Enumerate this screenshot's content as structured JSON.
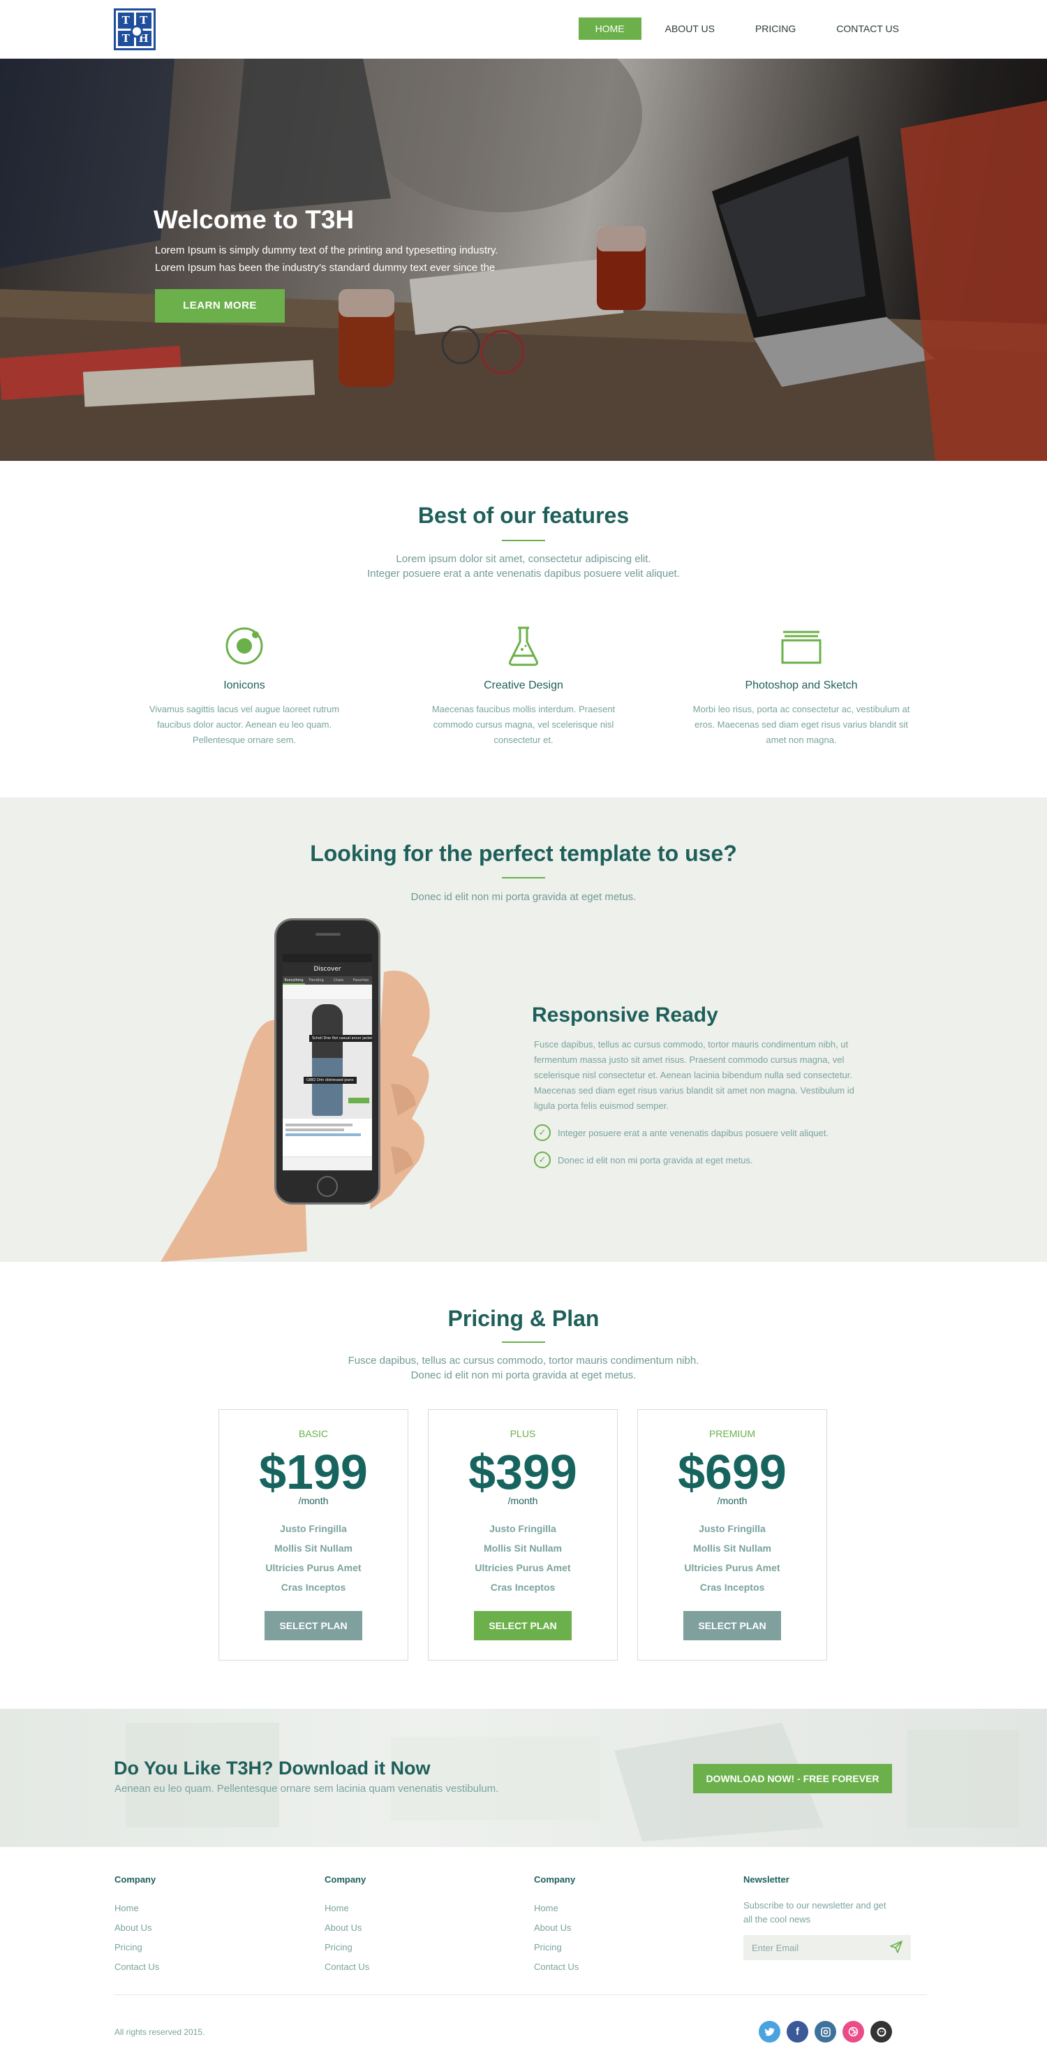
{
  "header": {
    "logo_letters": [
      "T",
      "T",
      "T",
      "H"
    ],
    "nav": [
      {
        "label": "HOME",
        "active": true
      },
      {
        "label": "ABOUT US",
        "active": false
      },
      {
        "label": "PRICING",
        "active": false
      },
      {
        "label": "CONTACT US",
        "active": false
      }
    ]
  },
  "hero": {
    "title": "Welcome to T3H",
    "text_line1": "Lorem Ipsum is simply dummy text of the printing and typesetting industry.",
    "text_line2": "Lorem Ipsum has been the industry's standard dummy text ever since the",
    "button": "LEARN MORE"
  },
  "features": {
    "title": "Best of our features",
    "subtitle_line1": "Lorem ipsum dolor sit amet, consectetur adipiscing elit.",
    "subtitle_line2": "Integer posuere erat a ante venenatis dapibus posuere velit aliquet.",
    "items": [
      {
        "icon": "ionicons-icon",
        "title": "Ionicons",
        "text": "Vivamus sagittis lacus vel augue laoreet rutrum faucibus dolor auctor. Aenean eu leo quam. Pellentesque ornare sem."
      },
      {
        "icon": "flask-icon",
        "title": "Creative Design",
        "text": "Maecenas faucibus mollis interdum. Praesent commodo cursus magna, vel scelerisque nisl consectetur et."
      },
      {
        "icon": "folder-icon",
        "title": "Photoshop and Sketch",
        "text": "Morbi leo risus, porta ac consectetur ac, vestibulum at eros. Maecenas sed diam eget risus varius blandit sit amet non magna."
      }
    ]
  },
  "template": {
    "title": "Looking for the perfect template to use?",
    "subtitle": "Donec id elit non mi porta gravida at eget metus.",
    "phone": {
      "screen_title": "Discover",
      "tabs": [
        "Everything",
        "Trending",
        "Chats",
        "Favorites"
      ],
      "caption1": "Scholl Drer Rot casual ancer jacket",
      "caption2": "G882 Drin distressed jeans"
    },
    "responsive": {
      "title": "Responsive Ready",
      "text": "Fusce dapibus, tellus ac cursus commodo, tortor mauris condimentum nibh, ut fermentum massa justo sit amet risus. Praesent commodo cursus magna, vel scelerisque nisl consectetur et. Aenean lacinia bibendum nulla sed consectetur. Maecenas sed diam eget risus varius blandit sit amet non magna. Vestibulum id ligula porta felis euismod semper.",
      "checks": [
        "Integer posuere erat a ante venenatis dapibus posuere velit aliquet.",
        "Donec id elit non mi porta gravida at eget metus."
      ]
    }
  },
  "pricing": {
    "title": "Pricing & Plan",
    "subtitle_line1": "Fusce dapibus, tellus ac cursus commodo, tortor mauris condimentum nibh.",
    "subtitle_line2": "Donec id elit non mi porta gravida at eget metus.",
    "plans": [
      {
        "name": "BASIC",
        "price": "$199",
        "per": "/month",
        "features": [
          "Justo Fringilla",
          "Mollis Sit Nullam",
          "Ultricies Purus Amet",
          "Cras Inceptos"
        ],
        "button": "SELECT PLAN",
        "highlight": false
      },
      {
        "name": "PLUS",
        "price": "$399",
        "per": "/month",
        "features": [
          "Justo Fringilla",
          "Mollis Sit Nullam",
          "Ultricies Purus Amet",
          "Cras Inceptos"
        ],
        "button": "SELECT PLAN",
        "highlight": true
      },
      {
        "name": "PREMIUM",
        "price": "$699",
        "per": "/month",
        "features": [
          "Justo Fringilla",
          "Mollis Sit Nullam",
          "Ultricies Purus Amet",
          "Cras Inceptos"
        ],
        "button": "SELECT PLAN",
        "highlight": false
      }
    ]
  },
  "download": {
    "title": "Do You Like T3H? Download it Now",
    "subtitle": "Aenean eu leo quam. Pellentesque ornare sem lacinia quam venenatis vestibulum.",
    "button": "DOWNLOAD NOW! - FREE FOREVER"
  },
  "footer": {
    "columns": [
      {
        "title": "Company",
        "links": [
          "Home",
          "About Us",
          "Pricing",
          "Contact Us"
        ]
      },
      {
        "title": "Company",
        "links": [
          "Home",
          "About Us",
          "Pricing",
          "Contact Us"
        ]
      },
      {
        "title": "Company",
        "links": [
          "Home",
          "About Us",
          "Pricing",
          "Contact Us"
        ]
      }
    ],
    "newsletter": {
      "title": "Newsletter",
      "text": "Subscribe to our newsletter and get all the cool news",
      "placeholder": "Enter Email"
    },
    "copyright": "All rights reserved 2015.",
    "social": [
      {
        "icon": "twitter-icon",
        "color": "#4aa3df"
      },
      {
        "icon": "facebook-icon",
        "color": "#3b5998"
      },
      {
        "icon": "instagram-icon",
        "color": "#3f729b"
      },
      {
        "icon": "dribbble-icon",
        "color": "#ea4c89"
      },
      {
        "icon": "github-icon",
        "color": "#333333"
      }
    ]
  },
  "colors": {
    "accent": "#6bb04a",
    "heading": "#1e5f5a",
    "body_text": "#7aa39e",
    "secondary_button": "#7fa09c"
  }
}
